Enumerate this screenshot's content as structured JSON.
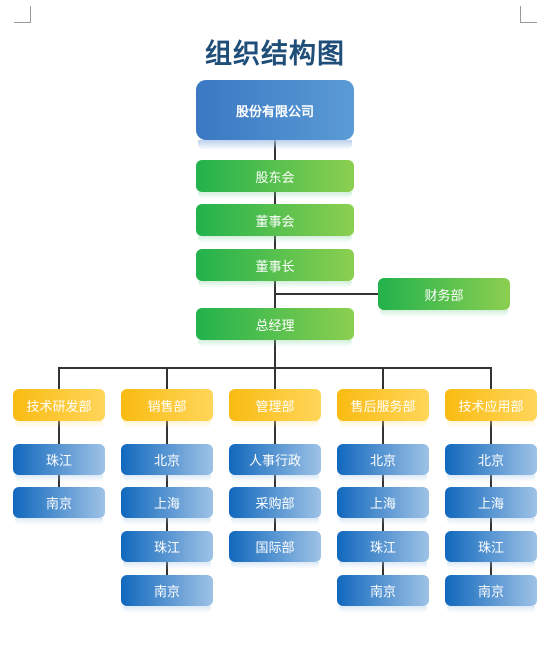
{
  "title": "组织结构图",
  "root": "股份有限公司",
  "chain": [
    "股东会",
    "董事会",
    "董事长",
    "总经理"
  ],
  "side_branch": "财务部",
  "departments": [
    {
      "name": "技术研发部",
      "children": [
        "珠江",
        "南京"
      ]
    },
    {
      "name": "销售部",
      "children": [
        "北京",
        "上海",
        "珠江",
        "南京"
      ]
    },
    {
      "name": "管理部",
      "children": [
        "人事行政",
        "采购部",
        "国际部"
      ]
    },
    {
      "name": "售后服务部",
      "children": [
        "北京",
        "上海",
        "珠江",
        "南京"
      ]
    },
    {
      "name": "技术应用部",
      "children": [
        "北京",
        "上海",
        "珠江",
        "南京"
      ]
    }
  ],
  "colors": {
    "title": "#1f4e79",
    "root": "#4a89cc",
    "executive": "#4cbf4e",
    "department": "#fcc52e",
    "branch": "#2f7cc8",
    "connector": "#333333"
  }
}
